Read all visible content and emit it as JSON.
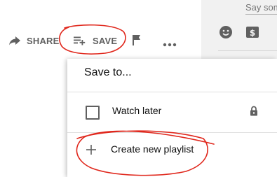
{
  "chat": {
    "input_text": "Say som",
    "emoji_icon": "emoji-icon",
    "money_icon": "super-chat-icon"
  },
  "actions": {
    "share_label": "SHARE",
    "save_label": "SAVE",
    "share_icon": "share-arrow-icon",
    "save_icon": "playlist-add-icon",
    "flag_icon": "flag-icon",
    "more_icon": "more-horizontal-icon"
  },
  "dropdown": {
    "title": "Save to...",
    "playlists": [
      {
        "label": "Watch later",
        "checked": false,
        "icon": "lock-icon"
      }
    ],
    "create_label": "Create new playlist",
    "create_icon": "plus-icon"
  },
  "colors": {
    "annotation": "#e0271c",
    "text_primary": "#0f0f0f",
    "text_secondary": "#606060",
    "chat_bg": "#f1f1f1"
  }
}
